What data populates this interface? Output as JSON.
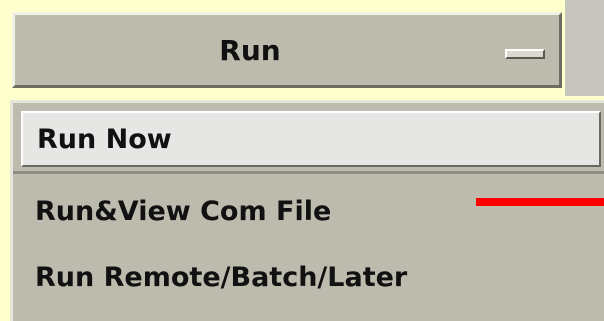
{
  "menu_button": {
    "label": "Run"
  },
  "menu": {
    "items": [
      {
        "label": "Run Now",
        "highlighted": true
      },
      {
        "label": "Run&View Com File",
        "highlighted": false
      },
      {
        "label": "Run Remote/Batch/Later",
        "highlighted": false
      }
    ]
  },
  "colors": {
    "background": "#FFFFCC",
    "widget": "#BDBBAD",
    "highlight": "#E6E6E4",
    "annotation_line": "#FF0000"
  }
}
